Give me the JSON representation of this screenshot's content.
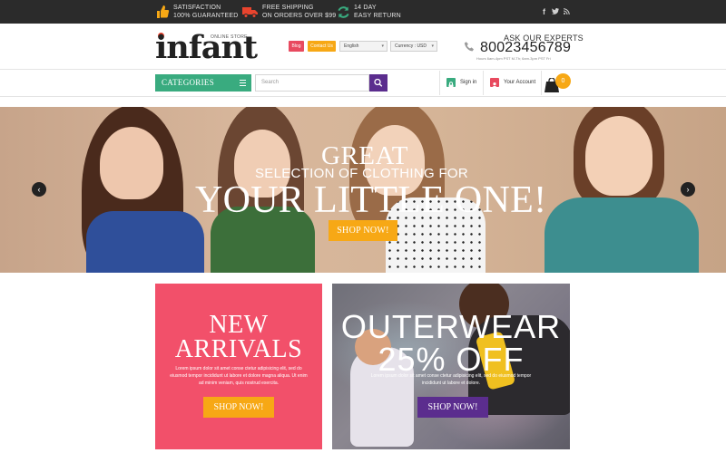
{
  "topbar": {
    "promos": [
      {
        "icon": "thumbs-up-icon",
        "line1": "SATISFACTION",
        "line2": "100% GUARANTEED"
      },
      {
        "icon": "truck-icon",
        "line1": "FREE SHIPPING",
        "line2": "ON ORDERS OVER $99"
      },
      {
        "icon": "refresh-icon",
        "line1": "14 DAY",
        "line2": "EASY RETURN"
      }
    ],
    "social": {
      "facebook": "f",
      "twitter": "t",
      "rss": "rss"
    }
  },
  "header": {
    "logo": "infant",
    "tagline": "ONLINE STORE",
    "blog_label": "Blog",
    "contact_label": "Contact Us",
    "language": "English",
    "currency": "Currency : USD",
    "ask": "ASK OUR EXPERTS",
    "phone": "80023456789",
    "hours": "Hours 6am-4pm PST M-Th;    6am-3pm PST Fri"
  },
  "nav": {
    "categories_label": "CATEGORIES",
    "search_placeholder": "Search",
    "signin_label": "Sign in",
    "account_label": "Your Account",
    "cart_count": "0"
  },
  "hero": {
    "line1": "GREAT",
    "line2": "SELECTION OF CLOTHING FOR",
    "line3": "YOUR LITTLE ONE!",
    "button": "SHOP NOW!",
    "prev": "‹",
    "next": "›"
  },
  "banner_new": {
    "title1": "NEW",
    "title2": "ARRIVALS",
    "body": "Lorem ipsum dolor sit amet conse ctetur adipisicing elit, sed do eiusmod tempor incididunt ut labore et dolore magna aliqua. Ut enim ad minim veniam, quis nostrud exercita.",
    "button": "SHOP NOW!"
  },
  "banner_out": {
    "title1": "OUTERWEAR",
    "title2": "25% OFF",
    "body": "Lorem ipsum dolor sit amet conse ctetur adipisicing elit, sed do eiusmod tempor incididunt ut labore et dolore.",
    "button": "SHOP NOW!"
  },
  "colors": {
    "accent_green": "#39ab7f",
    "accent_orange": "#f7a815",
    "accent_purple": "#5b2d8e",
    "accent_pink": "#f2506a",
    "blog_red": "#e84a5f",
    "logo_red": "#f0432d",
    "topbar": "#2b2b2b"
  }
}
